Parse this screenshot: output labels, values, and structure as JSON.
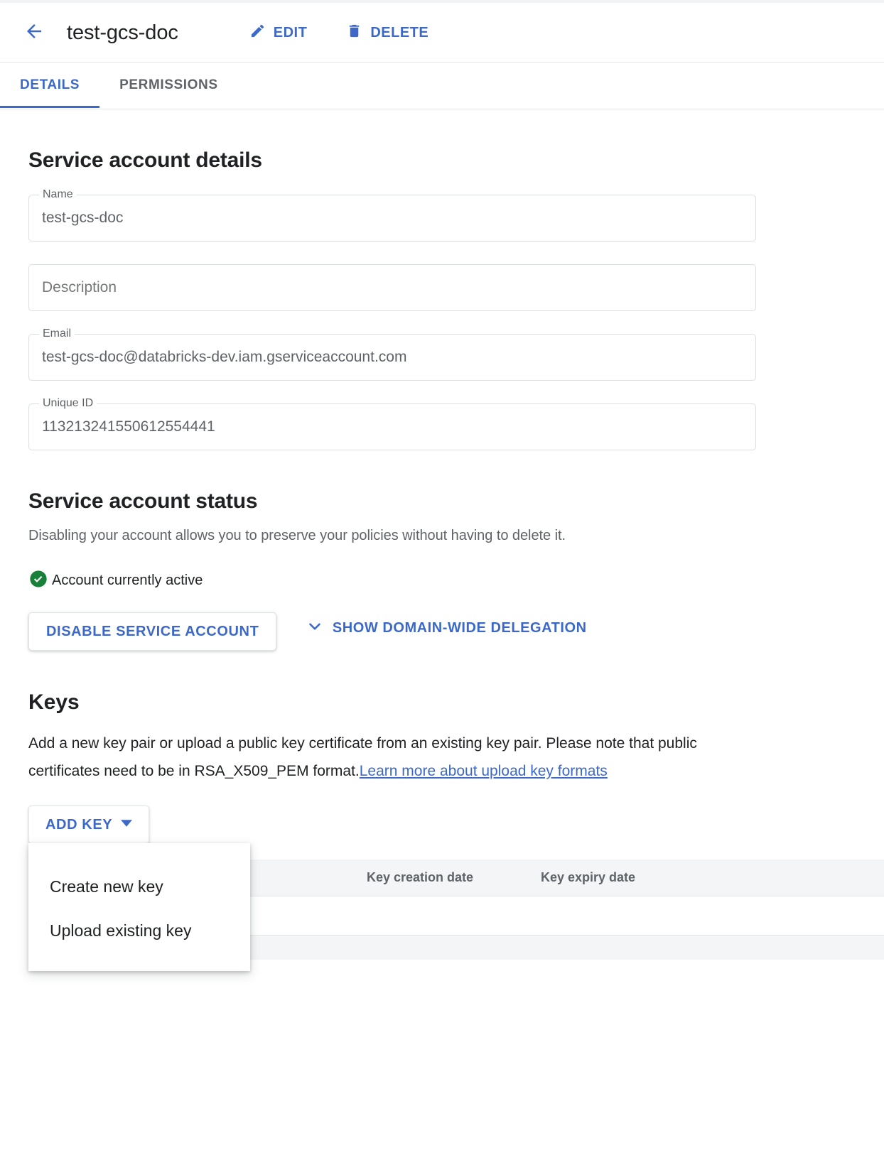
{
  "accent": "#3c68c8",
  "header": {
    "back_icon": "arrow-left-icon",
    "title": "test-gcs-doc",
    "actions": [
      {
        "icon": "pencil-icon",
        "label": "EDIT"
      },
      {
        "icon": "trash-icon",
        "label": "DELETE"
      }
    ]
  },
  "tabs": [
    {
      "label": "DETAILS",
      "active": true
    },
    {
      "label": "PERMISSIONS",
      "active": false
    }
  ],
  "details": {
    "heading": "Service account details",
    "fields": [
      {
        "legend": "Name",
        "value": "test-gcs-doc",
        "placeholder": ""
      },
      {
        "legend": "",
        "value": "",
        "placeholder": "Description"
      },
      {
        "legend": "Email",
        "value": "test-gcs-doc@databricks-dev.iam.gserviceaccount.com",
        "placeholder": ""
      },
      {
        "legend": "Unique ID",
        "value": "113213241550612554441",
        "placeholder": ""
      }
    ]
  },
  "status": {
    "heading": "Service account status",
    "description": "Disabling your account allows you to preserve your policies without having to delete it.",
    "state_icon": "check-circle-icon",
    "state_color": "#188038",
    "state_label": "Account currently active",
    "disable_button": "DISABLE SERVICE ACCOUNT",
    "delegation_icon": "chevron-down-icon",
    "delegation_label": "SHOW DOMAIN-WIDE DELEGATION"
  },
  "keys": {
    "heading": "Keys",
    "description_before": "Add a new key pair or upload a public key certificate from an existing key pair. Please note that public certificates need to be in RSA_X509_PEM format.",
    "description_link": "Learn more about upload key formats",
    "add_key_label": "ADD KEY",
    "add_key_icon": "caret-down-icon",
    "menu_open": true,
    "menu_items": [
      {
        "label": "Create new key"
      },
      {
        "label": "Upload existing key"
      }
    ],
    "table": {
      "columns": [
        "",
        "",
        "Key creation date",
        "Key expiry date",
        ""
      ],
      "rows": []
    }
  }
}
